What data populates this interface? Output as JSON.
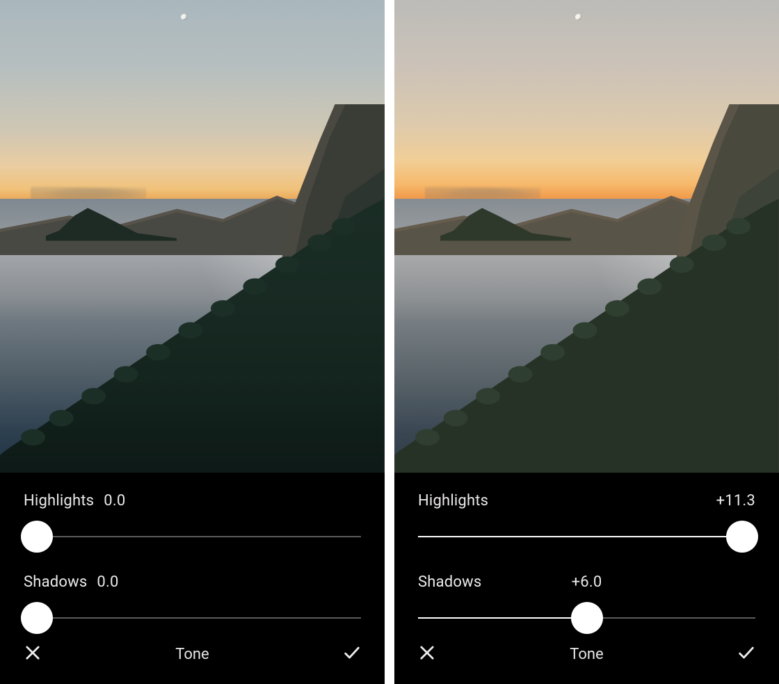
{
  "panels": [
    {
      "footer_title": "Tone",
      "highlights": {
        "label": "Highlights",
        "value_text": "0.0",
        "percent": 0
      },
      "shadows": {
        "label": "Shadows",
        "value_text": "0.0",
        "percent": 0
      },
      "value_align": "inline"
    },
    {
      "footer_title": "Tone",
      "highlights": {
        "label": "Highlights",
        "value_text": "+11.3",
        "percent": 94
      },
      "shadows": {
        "label": "Shadows",
        "value_text": "+6.0",
        "percent": 50
      },
      "value_align": "spread-center"
    }
  ],
  "icons": {
    "cancel": "close-icon",
    "confirm": "check-icon"
  }
}
